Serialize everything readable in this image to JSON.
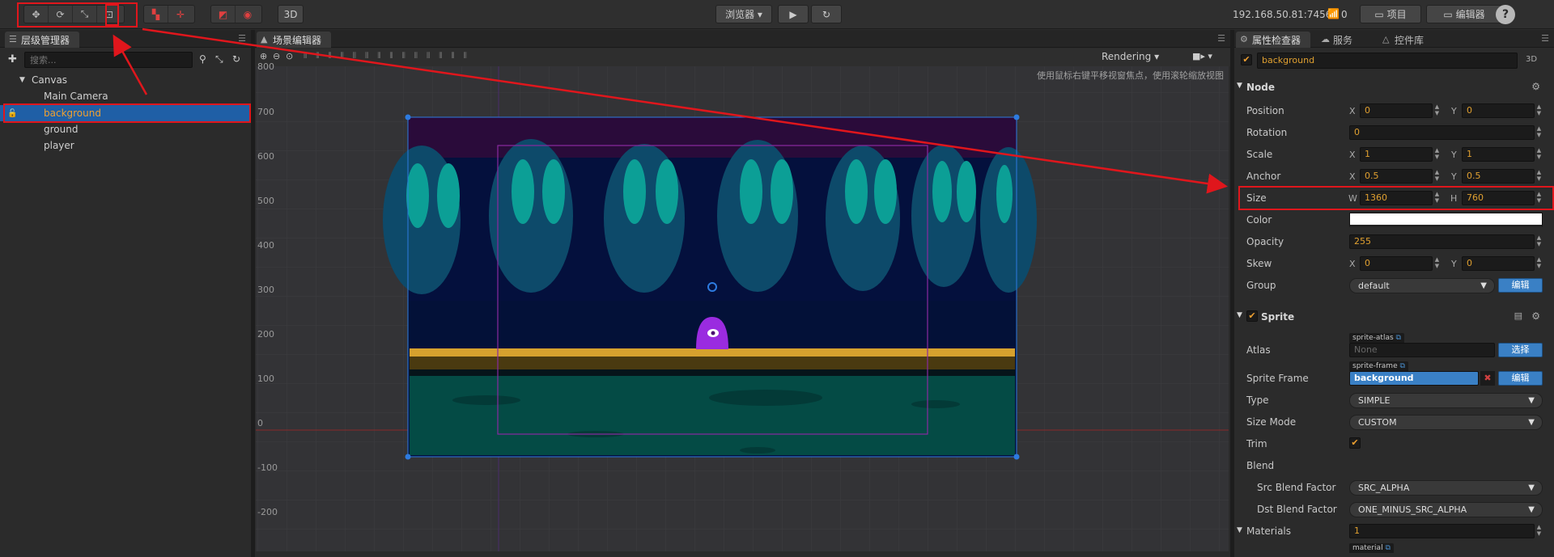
{
  "toolbar": {
    "btn_3d": "3D",
    "browser_label": "浏览器 ▾",
    "play_glyph": "▶",
    "refresh_glyph": "↻",
    "ip_address": "192.168.50.81:7456",
    "wifi_count": "0",
    "project_label": "项目",
    "editor_label": "编辑器",
    "help_glyph": "?"
  },
  "hierarchy": {
    "tab_label": "层级管理器",
    "search_placeholder": "搜索...",
    "items": [
      {
        "label": "Canvas",
        "arrow": "▼"
      },
      {
        "label": "Main Camera"
      },
      {
        "label": "background"
      },
      {
        "label": "ground"
      },
      {
        "label": "player"
      }
    ]
  },
  "scene": {
    "tab_label": "场景编辑器",
    "render_mode": "Rendering",
    "hint_text": "使用鼠标右键平移视窗焦点，使用滚轮缩放视图",
    "ruler_labels": [
      "800",
      "700",
      "600",
      "500",
      "400",
      "300",
      "200",
      "100",
      "0",
      "-100",
      "-200"
    ]
  },
  "inspector": {
    "tabs": [
      "属性检查器",
      "服务",
      "控件库"
    ],
    "node_name": "background",
    "badge_3d": "3D",
    "node_section": "Node",
    "position": {
      "label": "Position",
      "x": "0",
      "y": "0"
    },
    "rotation": {
      "label": "Rotation",
      "value": "0"
    },
    "scale": {
      "label": "Scale",
      "x": "1",
      "y": "1"
    },
    "anchor": {
      "label": "Anchor",
      "x": "0.5",
      "y": "0.5"
    },
    "size": {
      "label": "Size",
      "w": "1360",
      "h": "760"
    },
    "color": {
      "label": "Color",
      "value": "#ffffff"
    },
    "opacity": {
      "label": "Opacity",
      "value": "255"
    },
    "skew": {
      "label": "Skew",
      "x": "0",
      "y": "0"
    },
    "group": {
      "label": "Group",
      "value": "default",
      "button": "编辑"
    },
    "axis": {
      "x": "X",
      "y": "Y",
      "w": "W",
      "h": "H"
    },
    "sprite_section": "Sprite",
    "atlas": {
      "label": "Atlas",
      "tag": "sprite-atlas",
      "value": "None",
      "button": "选择"
    },
    "sprite_frame": {
      "label": "Sprite Frame",
      "tag": "sprite-frame",
      "value": "background",
      "button": "编辑"
    },
    "type": {
      "label": "Type",
      "value": "SIMPLE"
    },
    "size_mode": {
      "label": "Size Mode",
      "value": "CUSTOM"
    },
    "trim": {
      "label": "Trim",
      "checked": true
    },
    "blend": {
      "label": "Blend"
    },
    "src_blend": {
      "label": "Src Blend Factor",
      "value": "SRC_ALPHA"
    },
    "dst_blend": {
      "label": "Dst Blend Factor",
      "value": "ONE_MINUS_SRC_ALPHA"
    },
    "materials": {
      "label": "Materials",
      "value": "1",
      "tag": "material"
    }
  },
  "colors": {
    "selection_blue": "#1f5fa6",
    "value_orange": "#e0a030",
    "annotation_red": "#e0161c",
    "accent_blue_button": "#3a80c5"
  }
}
